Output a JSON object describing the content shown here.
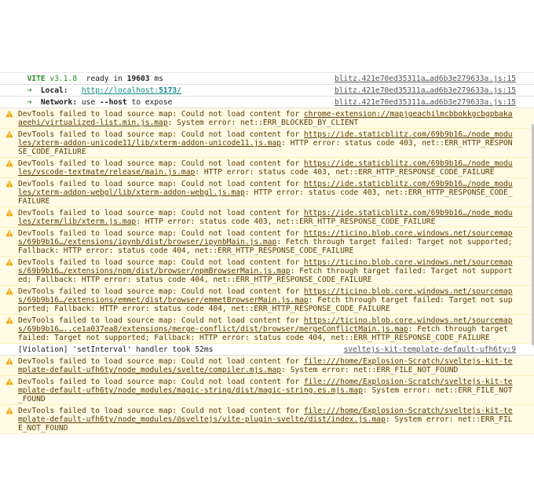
{
  "vite": {
    "brand": "VITE",
    "version": "v3.1.8",
    "ready_text": "ready in",
    "ready_ms": "19603",
    "ms": "ms",
    "local_label": "Local:",
    "local_url_base": "http://localhost:",
    "local_port": "5173",
    "local_url_tail": "/",
    "network_label": "Network:",
    "network_use": "use",
    "network_flag": "--host",
    "network_tail": "to expose",
    "arrow": "➜",
    "src": "blitz.421e70ed35311a…ad6b3e279633a.js:15"
  },
  "warnings": [
    {
      "prefix": "DevTools failed to load source map: Could not load content for ",
      "link": "chrome-extension://mapjgeachilmcbbokkgcbgpbakaaeehi/virtualized-list.min.js.map",
      "suffix": ": System error: net::ERR_BLOCKED_BY_CLIENT"
    },
    {
      "prefix": "DevTools failed to load source map: Could not load content for ",
      "link": "https://ide.staticblitz.com/69b9b16…/node_modules/xterm-addon-unicode11/lib/xterm-addon-unicode11.js.map",
      "suffix": ": HTTP error: status code 403, net::ERR_HTTP_RESPONSE_CODE_FAILURE"
    },
    {
      "prefix": "DevTools failed to load source map: Could not load content for ",
      "link": "https://ide.staticblitz.com/69b9b16…/node_modules/vscode-textmate/release/main.js.map",
      "suffix": ": HTTP error: status code 403, net::ERR_HTTP_RESPONSE_CODE_FAILURE"
    },
    {
      "prefix": "DevTools failed to load source map: Could not load content for ",
      "link": "https://ide.staticblitz.com/69b9b16…/node_modules/xterm-addon-webgl/lib/xterm-addon-webgl.js.map",
      "suffix": ": HTTP error: status code 403, net::ERR_HTTP_RESPONSE_CODE_FAILURE"
    },
    {
      "prefix": "DevTools failed to load source map: Could not load content for ",
      "link": "https://ide.staticblitz.com/69b9b16…/node_modules/xterm/lib/xterm.js.map",
      "suffix": ": HTTP error: status code 403, net::ERR_HTTP_RESPONSE_CODE_FAILURE"
    },
    {
      "prefix": "DevTools failed to load source map: Could not load content for ",
      "link": "https://ticino.blob.core.windows.net/sourcemaps/69b9b16…/extensions/ipynb/dist/browser/ipynbMain.js.map",
      "suffix": ": Fetch through target failed: Target not supported; Fallback: HTTP error: status code 404, net::ERR_HTTP_RESPONSE_CODE_FAILURE"
    },
    {
      "prefix": "DevTools failed to load source map: Could not load content for ",
      "link": "https://ticino.blob.core.windows.net/sourcemaps/69b9b16…/extensions/npm/dist/browser/npmBrowserMain.js.map",
      "suffix": ": Fetch through target failed: Target not supported; Fallback: HTTP error: status code 404, net::ERR_HTTP_RESPONSE_CODE_FAILURE"
    },
    {
      "prefix": "DevTools failed to load source map: Could not load content for ",
      "link": "https://ticino.blob.core.windows.net/sourcemaps/69b9b16…/extensions/emmet/dist/browser/emmetBrowserMain.js.map",
      "suffix": ": Fetch through target failed: Target not supported; Fallback: HTTP error: status code 404, net::ERR_HTTP_RESPONSE_CODE_FAILURE"
    },
    {
      "prefix": "DevTools failed to load source map: Could not load content for ",
      "link": "https://ticino.blob.core.windows.net/sourcemaps/69b9b16…..ce1a037ea8/extensions/merge-conflict/dist/browser/mergeConflictMain.js.map",
      "suffix": ": Fetch through target failed: Target not supported; Fallback: HTTP error: status code 404, net::ERR_HTTP_RESPONSE_CODE_FAILURE"
    }
  ],
  "violation": {
    "text": "[Violation] 'setInterval' handler took 52ms",
    "src": "sveltejs-kit-template-default-ufh6ty:9"
  },
  "warnings2": [
    {
      "prefix": "DevTools failed to load source map: Could not load content for ",
      "link": "file:///home/Explosion-Scratch/sveltejs-kit-template-default-ufh6ty/node_modules/svelte/compiler.mjs.map",
      "suffix": ": System error: net::ERR_FILE_NOT_FOUND"
    },
    {
      "prefix": "DevTools failed to load source map: Could not load content for ",
      "link": "file:///home/Explosion-Scratch/sveltejs-kit-template-default-ufh6ty/node_modules/magic-string/dist/magic-string.es.mjs.map",
      "suffix": ": System error: net::ERR_FILE_NOT_FOUND"
    },
    {
      "prefix": "DevTools failed to load source map: Could not load content for ",
      "link": "file:///home/Explosion-Scratch/sveltejs-kit-template-default-ufh6ty/node_modules/@sveltejs/vite-plugin-svelte/dist/index.js.map",
      "suffix": ": System error: net::ERR_FILE_NOT_FOUND"
    }
  ],
  "colors": {
    "warning_bg": "#fffbe5",
    "warning_text": "#5c3c00",
    "vite_green": "#2a8f2a",
    "port_teal": "#0e8a8a"
  }
}
